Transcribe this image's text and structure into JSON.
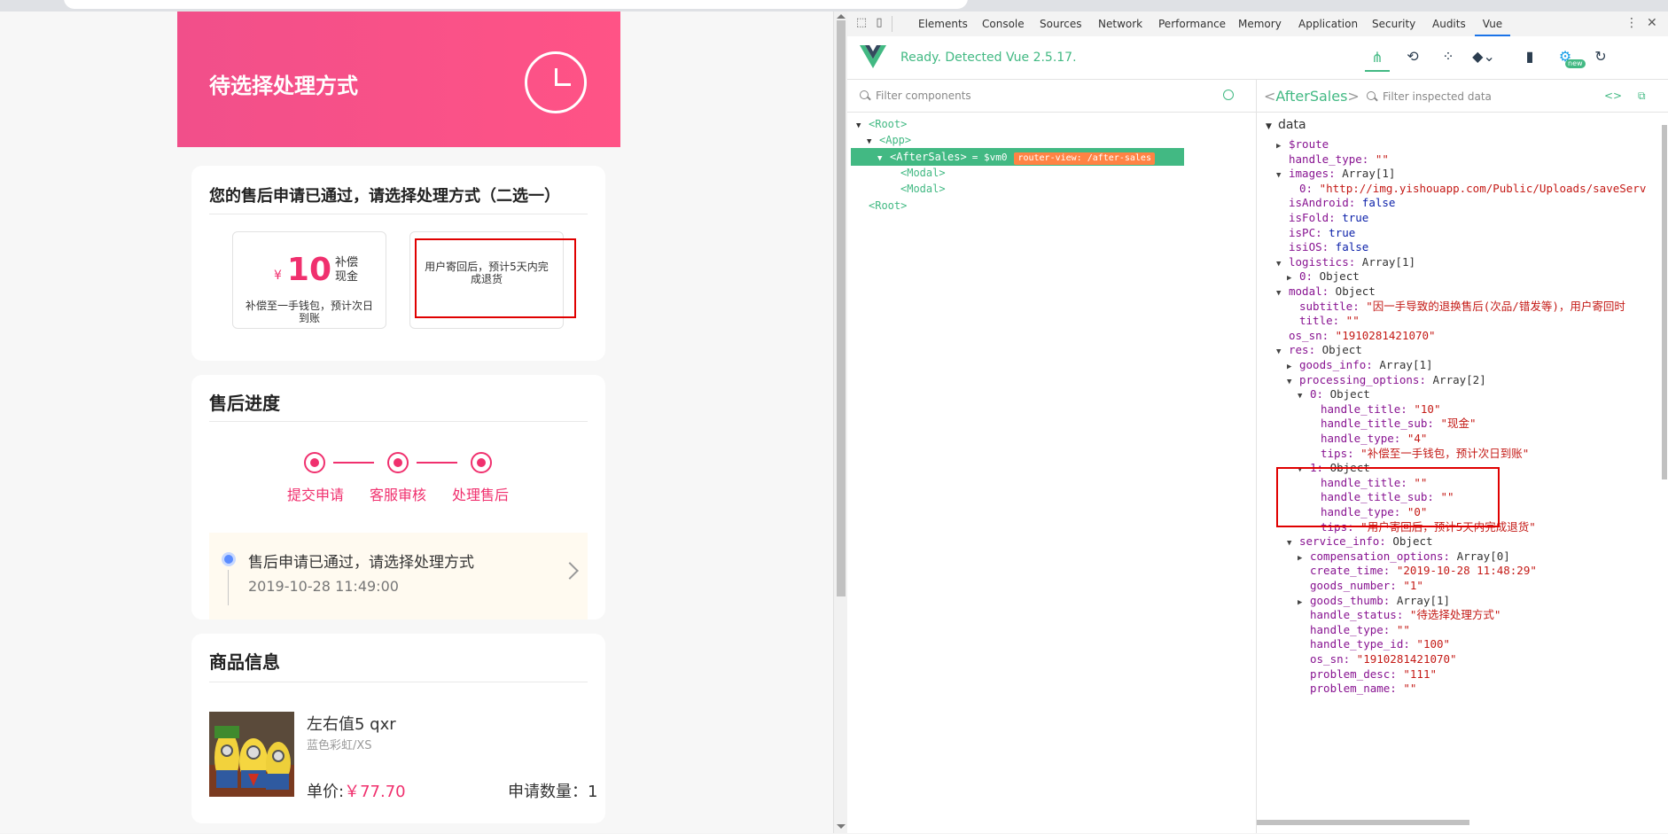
{
  "page": {
    "header_title": "待选择处理方式",
    "select_card": {
      "title": "您的售后申请已通过，请选择处理方式（二选一）",
      "option1": {
        "currency": "¥",
        "amount": "10",
        "sub": "补偿现金",
        "tips": "补偿至一手钱包，预计次日到账"
      },
      "option2": {
        "tips": "用户寄回后，预计5天内完成退货"
      }
    },
    "progress_card": {
      "title": "售后进度",
      "steps": [
        "提交申请",
        "客服审核",
        "处理售后"
      ],
      "notice_text": "售后申请已通过，请选择处理方式",
      "notice_time": "2019-10-28 11:49:00"
    },
    "goods_card": {
      "title": "商品信息",
      "name": "左右值5 qxr",
      "spec": "蓝色彩虹/XS",
      "price_label": "单价:",
      "price_value": "￥77.70",
      "qty": "申请数量：1"
    }
  },
  "devtools": {
    "tabs": [
      "Elements",
      "Console",
      "Sources",
      "Network",
      "Performance",
      "Memory",
      "Application",
      "Security",
      "Audits",
      "Vue"
    ],
    "active_tab": "Vue",
    "vue_status": "Ready. Detected Vue 2.5.17.",
    "new_badge": "new",
    "filter_components_placeholder": "Filter components",
    "tree": {
      "root1": "<Root>",
      "app": "<App>",
      "aftersales": "<AfterSales>",
      "vm_tag": "= $vm0",
      "router_view": "router-view: /after-sales",
      "modal1": "<Modal>",
      "modal2": "<Modal>",
      "root2": "<Root>"
    },
    "inspector": {
      "component_name": "AfterSales",
      "filter_placeholder": "Filter inspected data",
      "section": "data"
    },
    "data_lines": [
      [
        "$route",
        ""
      ],
      [
        "handle_type:",
        " \"\""
      ],
      [
        "images:",
        " Array[1]"
      ],
      [
        "0:",
        " \"http://img.yishouapp.com/Public/Uploads/saveServ"
      ],
      [
        "isAndroid:",
        " false"
      ],
      [
        "isFold:",
        " true"
      ],
      [
        "isPC:",
        " true"
      ],
      [
        "isiOS:",
        " false"
      ],
      [
        "logistics:",
        " Array[1]"
      ],
      [
        "0:",
        " Object"
      ],
      [
        "modal:",
        " Object"
      ],
      [
        "subtitle:",
        " \"因一手导致的退换售后(次品/错发等)，用户寄回时"
      ],
      [
        "title:",
        " \"\""
      ],
      [
        "os_sn:",
        " \"1910281421070\""
      ],
      [
        "res:",
        " Object"
      ],
      [
        "goods_info:",
        " Array[1]"
      ],
      [
        "processing_options:",
        " Array[2]"
      ],
      [
        "0:",
        " Object"
      ],
      [
        "handle_title:",
        " \"10\""
      ],
      [
        "handle_title_sub:",
        " \"现金\""
      ],
      [
        "handle_type:",
        " \"4\""
      ],
      [
        "tips:",
        " \"补偿至一手钱包，预计次日到账\""
      ],
      [
        "1:",
        " Object"
      ],
      [
        "handle_title:",
        " \"\""
      ],
      [
        "handle_title_sub:",
        " \"\""
      ],
      [
        "handle_type:",
        " \"0\""
      ],
      [
        "tips:",
        " \"用户寄回后，预计5天内完成退货\""
      ],
      [
        "service_info:",
        " Object"
      ],
      [
        "compensation_options:",
        " Array[0]"
      ],
      [
        "create_time:",
        " \"2019-10-28 11:48:29\""
      ],
      [
        "goods_number:",
        " \"1\""
      ],
      [
        "goods_thumb:",
        " Array[1]"
      ],
      [
        "handle_status:",
        " \"待选择处理方式\""
      ],
      [
        "handle_type:",
        " \"\""
      ],
      [
        "handle_type_id:",
        " \"100\""
      ],
      [
        "os_sn:",
        " \"1910281421070\""
      ],
      [
        "problem_desc:",
        " \"111\""
      ],
      [
        "problem_name:",
        " \"\""
      ]
    ]
  },
  "colors": {
    "brand_pink": "#f0306e",
    "vue_green": "#42b983",
    "highlight_red": "#e00000"
  }
}
